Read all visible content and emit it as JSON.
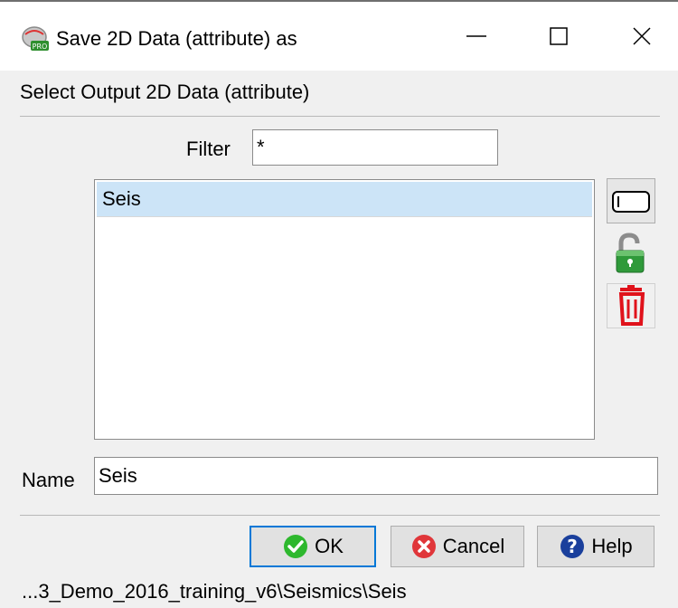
{
  "window": {
    "title": "Save 2D Data (attribute) as",
    "app_icon": "opendtect-pro-icon",
    "controls": {
      "minimize": "minimize-icon",
      "maximize": "maximize-icon",
      "close": "close-icon"
    }
  },
  "header": {
    "label": "Select Output 2D Data (attribute)"
  },
  "filter": {
    "label": "Filter",
    "value": "*"
  },
  "list": {
    "items": [
      {
        "label": "Seis",
        "selected": true
      }
    ]
  },
  "side_buttons": [
    {
      "icon": "rename-icon"
    },
    {
      "icon": "unlock-icon"
    },
    {
      "icon": "trash-icon"
    }
  ],
  "name": {
    "label": "Name",
    "value": "Seis"
  },
  "buttons": {
    "ok": "OK",
    "cancel": "Cancel",
    "help": "Help"
  },
  "status": {
    "path": "...3_Demo_2016_training_v6\\Seismics\\Seis"
  },
  "colors": {
    "selection": "#cce4f7",
    "ok_border": "#0078d7",
    "check_green": "#2eb82e",
    "cancel_red": "#e0363a",
    "help_blue": "#1a3f9c"
  }
}
